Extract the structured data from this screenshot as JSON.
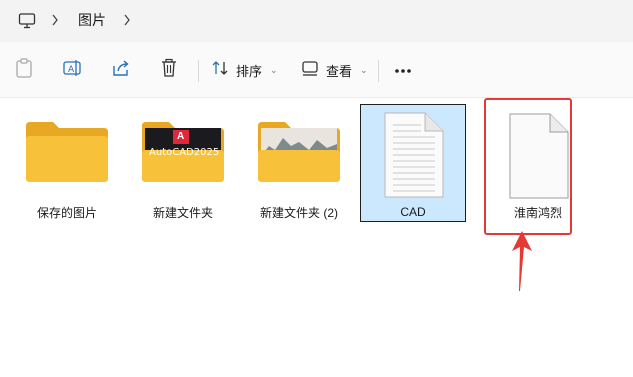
{
  "address": {
    "breadcrumb": [
      "图片"
    ],
    "icon": "monitor-icon"
  },
  "toolbar": {
    "sort_label": "排序",
    "view_label": "查看",
    "more_label": "···",
    "icons": [
      "paste-icon",
      "rename-icon",
      "share-icon",
      "delete-icon",
      "sort-icon",
      "view-icon",
      "more-icon"
    ]
  },
  "files": [
    {
      "name": "保存的图片",
      "type": "folder",
      "thumbnail": "plain"
    },
    {
      "name": "新建文件夹",
      "type": "folder",
      "thumbnail": "autocad",
      "thumb_text": "AutoCAD2025",
      "thumb_letter": "A"
    },
    {
      "name": "新建文件夹 (2)",
      "type": "folder",
      "thumbnail": "landscape"
    },
    {
      "name": "CAD",
      "type": "text-file",
      "selected": true
    },
    {
      "name": "淮南鸿烈",
      "type": "blank-file",
      "highlighted": true
    }
  ],
  "colors": {
    "folder_yellow": "#f8c13a",
    "selection_bg": "#cce8ff",
    "annotation_red": "#e53935"
  }
}
